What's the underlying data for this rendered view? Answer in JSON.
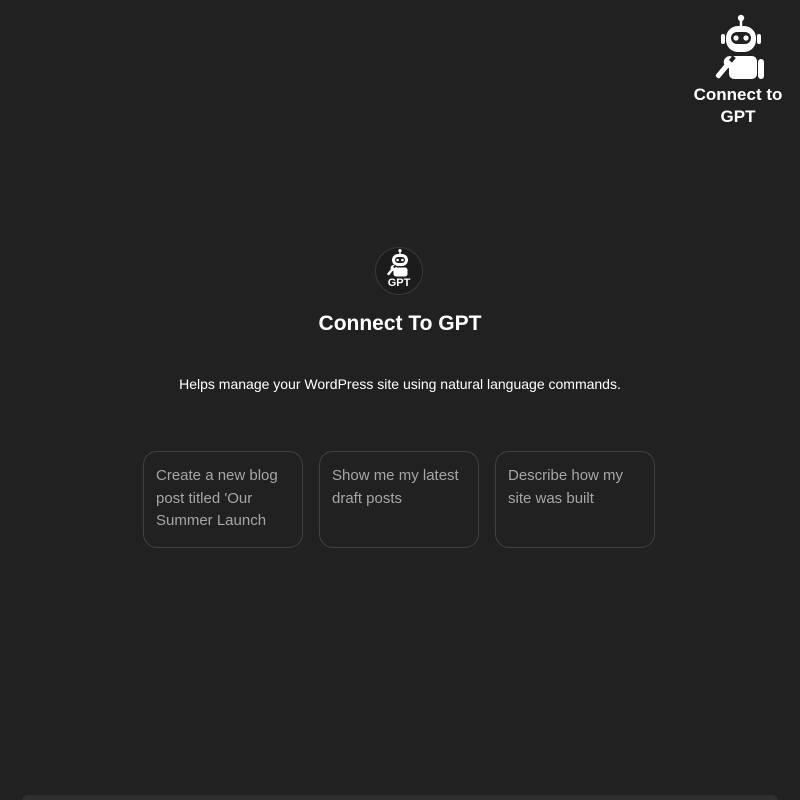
{
  "corner_logo": {
    "icon": "robot-wrench-icon",
    "label": "Connect to GPT"
  },
  "header": {
    "avatar_icon": "robot-wrench-icon",
    "avatar_text": "GPT",
    "title": "Connect To GPT",
    "description": "Helps manage your WordPress site using natural language commands."
  },
  "suggestions": [
    {
      "text": "Create a new blog post titled 'Our Summer Launch"
    },
    {
      "text": "Show me my latest draft posts"
    },
    {
      "text": "Describe how my site was built"
    }
  ],
  "colors": {
    "background": "#212121",
    "card_border": "#424242",
    "card_text": "#a6a6a6",
    "text": "#ffffff"
  }
}
